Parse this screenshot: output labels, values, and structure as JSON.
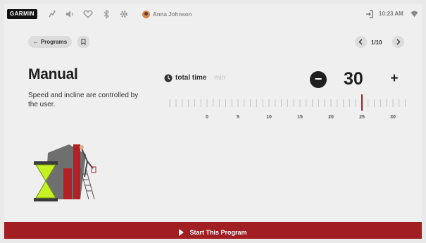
{
  "statusbar": {
    "brand": "GARMIN",
    "icons": [
      "cadence-icon",
      "volume-icon",
      "heart-icon",
      "bluetooth-icon",
      "settings-icon"
    ],
    "user_name": "Anna Johnson",
    "time": "10:23 AM"
  },
  "nav": {
    "back_label": "Programs",
    "pager": "1/10"
  },
  "program": {
    "title": "Manual",
    "description": "Speed and incline are controlled by the user."
  },
  "total_time": {
    "label": "total time",
    "unit": "min",
    "value": "30",
    "minus": "−",
    "plus": "+",
    "ticks": [
      "0",
      "5",
      "10",
      "15",
      "20",
      "25",
      "30"
    ],
    "current_marker": 25
  },
  "start": {
    "label": "Start This Program"
  },
  "colors": {
    "accent": "#a11e22",
    "illustration_green": "#c5f224",
    "illustration_red": "#b32025"
  }
}
